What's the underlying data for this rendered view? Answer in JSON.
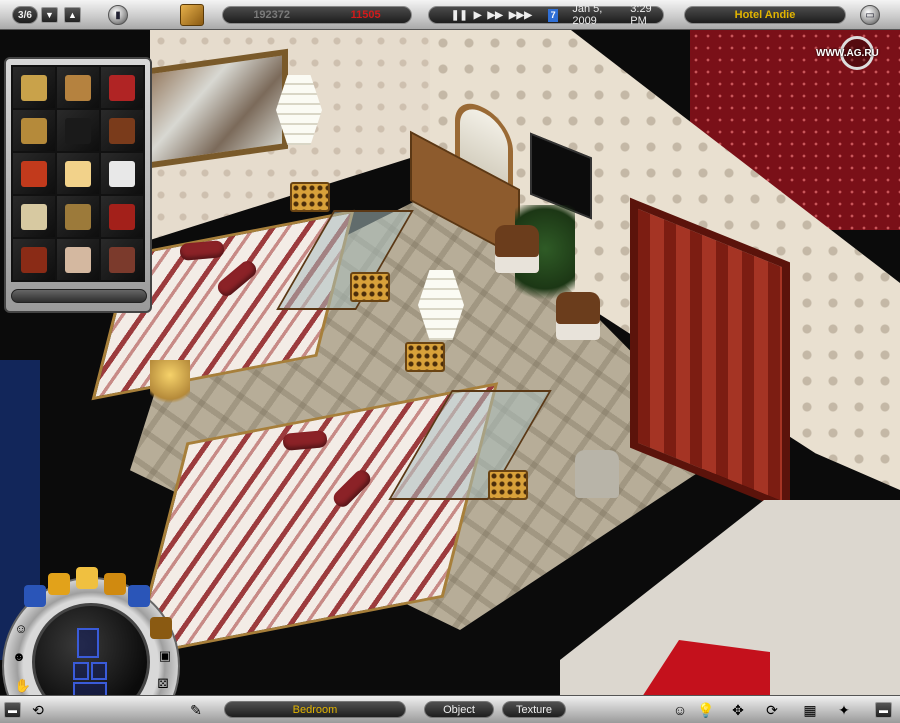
{
  "topbar": {
    "floor_indicator": "3/6",
    "money": "192372",
    "income": "11505",
    "date": "Jan 5, 2009",
    "time": "3:29 PM",
    "hotel_name": "Hotel Andie",
    "calendar_day": "7",
    "speed_controls": [
      "pause-icon",
      "play-icon",
      "fast-forward-icon",
      "fastest-icon"
    ]
  },
  "watermark": {
    "text": "WWW.AG.RU"
  },
  "bottombar": {
    "room_label": "Bedroom",
    "object_tab": "Object",
    "texture_tab": "Texture"
  },
  "catalog": {
    "items": [
      "armchair-icon",
      "rug-icon",
      "red-chair-icon",
      "floor-lamp-icon",
      "tv-icon",
      "cabinet-icon",
      "fruit-bowl-icon",
      "table-lamp-icon",
      "pattern-screen-icon",
      "mirror-icon",
      "plant-vase-icon",
      "red-dresser-icon",
      "red-table-icon",
      "curtain-icon",
      "striped-bed-icon"
    ],
    "item_colors": [
      "#c9a24a",
      "#b5823f",
      "#b02424",
      "#b58a3a",
      "#1a1a1a",
      "#7a3b1b",
      "#c23a1c",
      "#f2d28a",
      "#e8e8e8",
      "#d7c9a1",
      "#9c7a3a",
      "#a3201a",
      "#8a2b16",
      "#d4b8a0",
      "#7b3a2c"
    ]
  },
  "colors": {
    "money_color": "#7a7a7a",
    "income_color": "#d21a1a",
    "hotel_name_color": "#e2b400",
    "room_label_color": "#e2b400"
  }
}
